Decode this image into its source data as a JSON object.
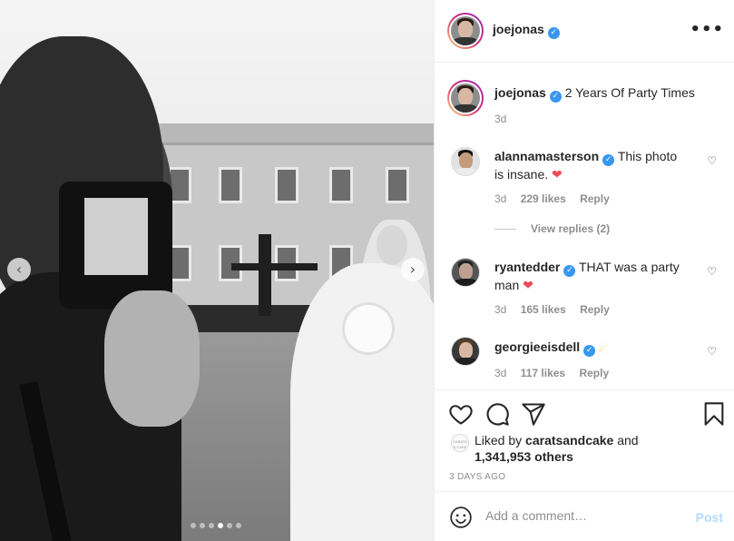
{
  "post": {
    "username": "joejonas",
    "caption": "2 Years Of Party Times",
    "caption_time": "3d",
    "slide_dots": 6,
    "active_slide": 3
  },
  "header": {
    "username": "joejonas",
    "more_label": "•••"
  },
  "comments": [
    {
      "user": "alannamasterson",
      "text_line1": "This photo",
      "text_line2": "is insane.",
      "time": "3d",
      "likes": "229 likes",
      "reply": "Reply"
    },
    {
      "user": "ryantedder",
      "text_line1": "THAT was a party",
      "text_line2": "man",
      "time": "3d",
      "likes": "165 likes",
      "reply": "Reply"
    },
    {
      "user": "georgieeisdell",
      "text_line1": "",
      "time": "3d",
      "likes": "117 likes",
      "reply": "Reply"
    }
  ],
  "view_replies": "View replies (2)",
  "likes": {
    "prefix": "Liked by",
    "user": "caratsandcake",
    "and": "and",
    "count": "1,341,953 others",
    "avatar_text": "CARATS & CAKE"
  },
  "posted_ago": "3 DAYS AGO",
  "add_comment": {
    "placeholder": "Add a comment…",
    "post_label": "Post"
  },
  "nav": {
    "prev": "‹",
    "next": "›"
  },
  "icons": [
    "heart-icon",
    "comment-icon",
    "share-icon",
    "bookmark-icon",
    "emoji-icon",
    "verified-icon",
    "more-icon"
  ],
  "colors": {
    "accent": "#3897f0",
    "post_disabled": "#b3dbff",
    "like_red": "#ed4956",
    "muted": "#8e8e8e"
  }
}
